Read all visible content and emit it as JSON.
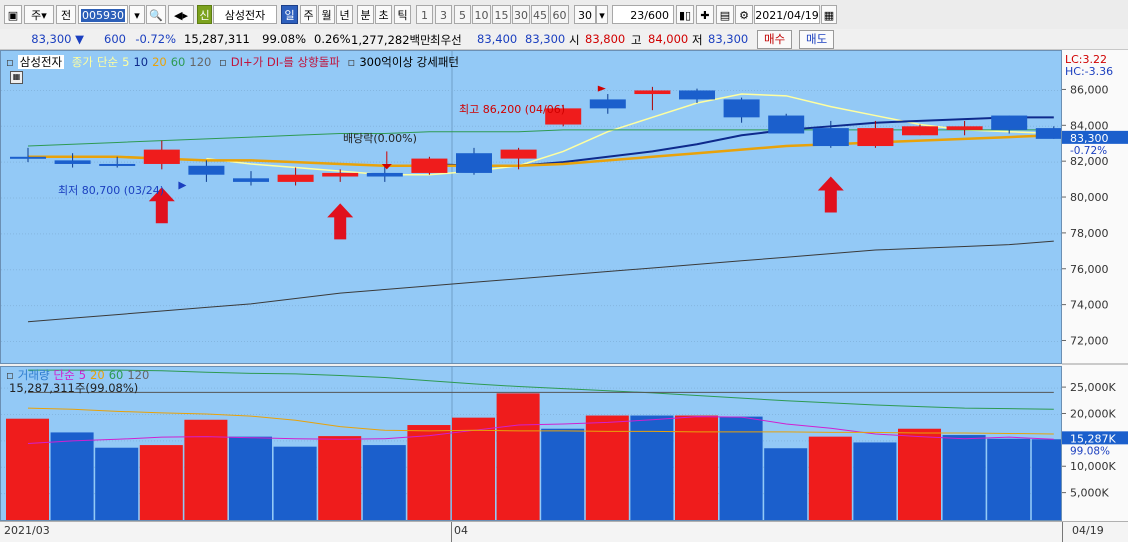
{
  "toolbar": {
    "market": "주",
    "prev": "전",
    "code": "005930",
    "stock_badge": "신",
    "stock_name": "삼성전자",
    "periods": [
      "일",
      "주",
      "월",
      "년",
      "분",
      "초",
      "틱"
    ],
    "selected_period": "일",
    "intervals": [
      "1",
      "3",
      "5",
      "10",
      "15",
      "30",
      "45",
      "60"
    ],
    "interval_value": "30",
    "page_counter": "23/600",
    "date": "2021/04/19",
    "icons": [
      "window-icon",
      "dropdown-icon",
      "search-icon",
      "speaker-icon",
      "candle-icon",
      "crosshair-icon",
      "save-icon",
      "gear-icon",
      "calendar-icon"
    ]
  },
  "quote": {
    "price": "83,300 ▼",
    "change": "600",
    "change_pct": "-0.72%",
    "volume": "15,287,311",
    "volume_pct": "99.08%",
    "turnover_pct": "0.26%",
    "amount": "1,277,282백만",
    "best_label": "최우선",
    "best_ask": "83,400",
    "best_bid": "83,300",
    "open_label": "시",
    "open": "83,800",
    "high_label": "고",
    "high": "84,000",
    "low_label": "저",
    "low": "83,300",
    "buy_button": "매수",
    "sell_button": "매도"
  },
  "price_legend": {
    "name": "삼성전자",
    "close_label": "종가",
    "ma_label": "단순",
    "periods": [
      "5",
      "10",
      "20",
      "60",
      "120"
    ],
    "di_signal": "DI+가 DI-를 상향돌파",
    "pattern": "300억이상 강세패턴"
  },
  "annotations": {
    "dividend": "배당락(0.00%)",
    "high": "최고 86,200 (04/06)",
    "low": "최저 80,700 (03/24)"
  },
  "volume_legend": {
    "label": "거래량",
    "ma_label": "단순",
    "periods": [
      "5",
      "20",
      "60",
      "120"
    ],
    "current": "15,287,311주(99.08%)"
  },
  "price_axis": {
    "lc": "LC:3.22",
    "hc": "HC:-3.36",
    "ticks": [
      "86,000",
      "84,000",
      "82,000",
      "80,000",
      "78,000",
      "76,000",
      "74,000",
      "72,000"
    ],
    "current_price": "83,300",
    "current_pct": "-0.72%"
  },
  "volume_axis": {
    "ticks": [
      "25,000K",
      "20,000K",
      "15,000K",
      "10,000K",
      "5,000K"
    ],
    "current": "15,287K",
    "current_pct": "99.08%"
  },
  "date_axis": {
    "start": "2021/03",
    "mid": "04",
    "end": "04/19"
  },
  "colors": {
    "up": "#ef1c1c",
    "down": "#1b5fcc",
    "ma5": "#ffffa0",
    "ma10": "#0e2a8c",
    "ma20": "#e8a20a",
    "ma60": "#2e9a52",
    "ma120": "#3a3a3a",
    "bg": "#93c9f6",
    "arrow": "#e0101e"
  },
  "chart_data": [
    {
      "type": "candlestick",
      "title": "삼성전자",
      "y_unit": "KRW",
      "ylim": [
        70800,
        88200
      ],
      "candles": [
        {
          "open": 82300,
          "high": 82800,
          "low": 82000,
          "close": 82200
        },
        {
          "open": 82100,
          "high": 82500,
          "low": 81700,
          "close": 81900
        },
        {
          "open": 81900,
          "high": 82300,
          "low": 81700,
          "close": 81800
        },
        {
          "open": 81900,
          "high": 83200,
          "low": 81600,
          "close": 82700
        },
        {
          "open": 81800,
          "high": 82100,
          "low": 80900,
          "close": 81300
        },
        {
          "open": 81100,
          "high": 81500,
          "low": 80700,
          "close": 80900
        },
        {
          "open": 80900,
          "high": 81700,
          "low": 80700,
          "close": 81300
        },
        {
          "open": 81200,
          "high": 81600,
          "low": 80900,
          "close": 81400
        },
        {
          "open": 81400,
          "high": 81800,
          "low": 80900,
          "close": 81200
        },
        {
          "open": 81400,
          "high": 82300,
          "low": 81300,
          "close": 82200
        },
        {
          "open": 82500,
          "high": 82800,
          "low": 81300,
          "close": 81400
        },
        {
          "open": 82200,
          "high": 82800,
          "low": 81600,
          "close": 82700
        },
        {
          "open": 84100,
          "high": 85200,
          "low": 84000,
          "close": 85000
        },
        {
          "open": 85500,
          "high": 85800,
          "low": 84700,
          "close": 85000
        },
        {
          "open": 85800,
          "high": 86200,
          "low": 84900,
          "close": 86000
        },
        {
          "open": 86000,
          "high": 86100,
          "low": 85300,
          "close": 85500
        },
        {
          "open": 85500,
          "high": 85600,
          "low": 84200,
          "close": 84500
        },
        {
          "open": 84600,
          "high": 84700,
          "low": 83700,
          "close": 83600
        },
        {
          "open": 83900,
          "high": 84300,
          "low": 82800,
          "close": 82900
        },
        {
          "open": 82900,
          "high": 84300,
          "low": 82800,
          "close": 83900
        },
        {
          "open": 83500,
          "high": 84100,
          "low": 83500,
          "close": 84000
        },
        {
          "open": 83800,
          "high": 84300,
          "low": 83500,
          "close": 84000
        },
        {
          "open": 84600,
          "high": 84600,
          "low": 83600,
          "close": 83800
        },
        {
          "open": 83900,
          "high": 84000,
          "low": 83300,
          "close": 83300
        }
      ],
      "series": [
        {
          "name": "5",
          "values": [
            null,
            null,
            null,
            null,
            82200,
            81900,
            81700,
            81500,
            81300,
            81300,
            81500,
            81800,
            82600,
            83700,
            84500,
            85300,
            85800,
            85700,
            85100,
            84600,
            84100,
            83800,
            83700,
            83600
          ]
        },
        {
          "name": "10",
          "values": [
            null,
            null,
            null,
            null,
            null,
            null,
            null,
            null,
            null,
            81900,
            81800,
            81800,
            82000,
            82300,
            82600,
            83000,
            83500,
            83800,
            84000,
            84200,
            84300,
            84400,
            84500,
            84500
          ]
        },
        {
          "name": "20",
          "values": [
            82300,
            82300,
            82300,
            82200,
            82100,
            82100,
            82000,
            81900,
            81800,
            81800,
            81800,
            81800,
            81900,
            82100,
            82300,
            82500,
            82700,
            82900,
            83000,
            83100,
            83200,
            83300,
            83400,
            83500
          ]
        },
        {
          "name": "60",
          "values": [
            82900,
            83000,
            83100,
            83200,
            83300,
            83400,
            83500,
            83600,
            83600,
            83700,
            83700,
            83700,
            83800,
            83800,
            83800,
            83800,
            83800,
            83800,
            83800,
            83800,
            83800,
            83800,
            83800,
            83800
          ]
        },
        {
          "name": "120",
          "values": [
            73100,
            73300,
            73500,
            73700,
            73900,
            74100,
            74400,
            74700,
            74900,
            75100,
            75300,
            75500,
            75700,
            75900,
            76100,
            76300,
            76500,
            76700,
            76900,
            77100,
            77200,
            77300,
            77400,
            77600
          ]
        }
      ]
    },
    {
      "type": "bar",
      "title": "거래량",
      "y_unit": "K shares",
      "ylim": [
        0,
        29000
      ],
      "colors": [
        "up",
        "down",
        "down",
        "up",
        "up",
        "down",
        "down",
        "up",
        "down",
        "up",
        "up",
        "up",
        "down",
        "up",
        "down",
        "up",
        "down",
        "down",
        "up",
        "down",
        "up",
        "down",
        "down",
        "down"
      ],
      "values": [
        19200,
        16600,
        13700,
        14200,
        19000,
        15800,
        13900,
        15900,
        14200,
        18000,
        19400,
        24000,
        17300,
        19800,
        19800,
        19800,
        19600,
        13600,
        15800,
        14700,
        17300,
        16100,
        15400,
        15300
      ],
      "series": [
        {
          "name": "5",
          "values": [
            14500,
            15000,
            15300,
            15700,
            15800,
            15600,
            15400,
            15300,
            15400,
            16000,
            17000,
            18000,
            18200,
            18500,
            19000,
            19600,
            19500,
            18200,
            17400,
            16300,
            15800,
            15400,
            15700,
            15300
          ]
        },
        {
          "name": "20",
          "values": [
            21200,
            21000,
            20600,
            20300,
            20100,
            19700,
            18900,
            17700,
            17000,
            16900,
            17000,
            16900,
            16900,
            16800,
            16800,
            16700,
            16700,
            16700,
            16600,
            16600,
            16500,
            16500,
            16400,
            16300
          ]
        },
        {
          "name": "60",
          "values": [
            28400,
            28400,
            28400,
            28300,
            28000,
            27800,
            27700,
            27400,
            27000,
            26400,
            25800,
            25300,
            24900,
            24500,
            24100,
            23600,
            23100,
            22600,
            22200,
            21800,
            21500,
            21200,
            21100,
            21000
          ]
        },
        {
          "name": "120",
          "values": [
            24200,
            24200,
            24200,
            24200,
            24200,
            24200,
            24200,
            24200,
            24200,
            24200,
            24200,
            24200,
            24200,
            24200,
            24200,
            24200,
            24200,
            24200,
            24200,
            24200,
            24200,
            24200,
            24200,
            24200
          ]
        }
      ]
    }
  ]
}
